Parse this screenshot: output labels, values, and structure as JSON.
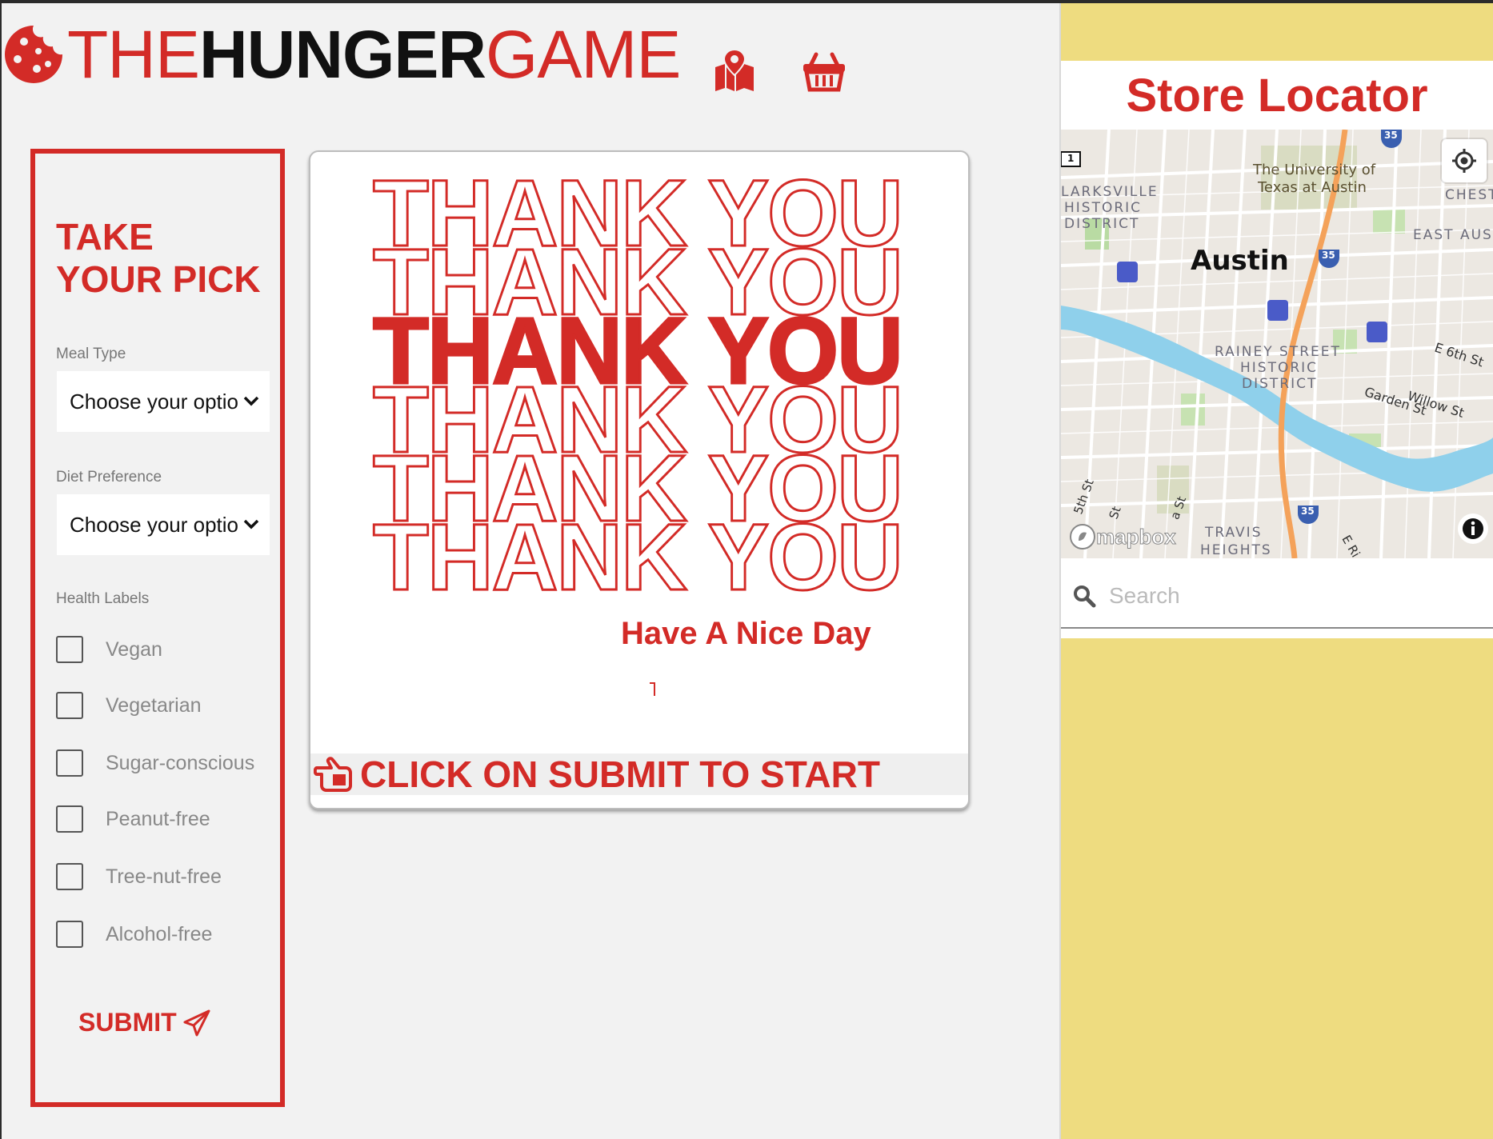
{
  "brand": {
    "logo_word_1": "THE",
    "logo_word_2": "HUNGER",
    "logo_word_3": "GAME",
    "primary_color": "#d32b27",
    "logo_icon": "cookie-icon"
  },
  "header": {
    "icons": [
      "map-icon",
      "basket-icon"
    ]
  },
  "filters": {
    "title_line_1": "TAKE",
    "title_line_2": "YOUR PICK",
    "meal_type_label": "Meal Type",
    "meal_type_value": "Choose your option",
    "diet_label": "Diet Preference",
    "diet_value": "Choose your option",
    "health_label": "Health Labels",
    "health_options": [
      {
        "label": "Vegan",
        "checked": false
      },
      {
        "label": "Vegetarian",
        "checked": false
      },
      {
        "label": "Sugar-conscious",
        "checked": false
      },
      {
        "label": "Peanut-free",
        "checked": false
      },
      {
        "label": "Tree-nut-free",
        "checked": false
      },
      {
        "label": "Alcohol-free",
        "checked": false
      }
    ],
    "submit_label": "SUBMIT"
  },
  "card": {
    "thank_you_lines": [
      "THANK YOU",
      "THANK YOU",
      "THANK YOU",
      "THANK YOU",
      "THANK YOU",
      "THANK YOU"
    ],
    "nice_day": "Have A Nice Day",
    "start_text": "CLICK ON SUBMIT TO START"
  },
  "store_locator": {
    "title": "Store Locator",
    "map_labels": {
      "university": "The University of",
      "university_2": "Texas at Austin",
      "clarksville": "LARKSVILLE",
      "historic": "HISTORIC",
      "district": "DISTRICT",
      "city": "Austin",
      "east_austin": "EAST AUS",
      "chest": "CHEST",
      "rainey": "RAINEY STREET",
      "rainey_2": "HISTORIC",
      "rainey_3": "DISTRICT",
      "e6th": "E 6th St",
      "willow": "Willow St",
      "garden": "Garden St",
      "travis": "TRAVIS",
      "heights": "HEIGHTS",
      "fifth": "5th St",
      "st1": "St",
      "st2": "a St",
      "eri": "E Ri",
      "hwy": "35",
      "route": "1"
    },
    "attribution": "mapbox",
    "search_placeholder": "Search"
  }
}
